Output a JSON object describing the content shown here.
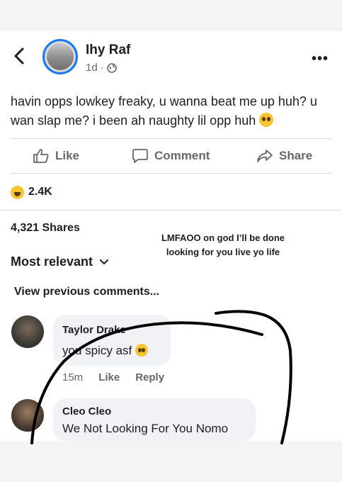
{
  "post": {
    "author": "Ihy Raf",
    "time": "1d",
    "separator": "·",
    "text": "havin opps lowkey freaky, u wanna beat me up huh? u wan slap me? i been ah naughty lil opp huh"
  },
  "actions": {
    "like": "Like",
    "comment": "Comment",
    "share": "Share"
  },
  "reactions": {
    "count": "2.4K"
  },
  "shares": "4,321 Shares",
  "overlay_caption": "LMFAOO on god I’ll be done looking for you live yo life",
  "sort": {
    "label": "Most relevant"
  },
  "view_previous": "View previous comments...",
  "comments": [
    {
      "name": "Taylor Drake",
      "text": "you spicy asf",
      "time": "15m",
      "like": "Like",
      "reply": "Reply"
    },
    {
      "name": "Cleo Cleo",
      "text": "We Not Looking For You Nomo"
    }
  ],
  "colors": {
    "accent": "#1877f2",
    "secondary_text": "#65676b",
    "bubble": "#f0f2f5"
  }
}
